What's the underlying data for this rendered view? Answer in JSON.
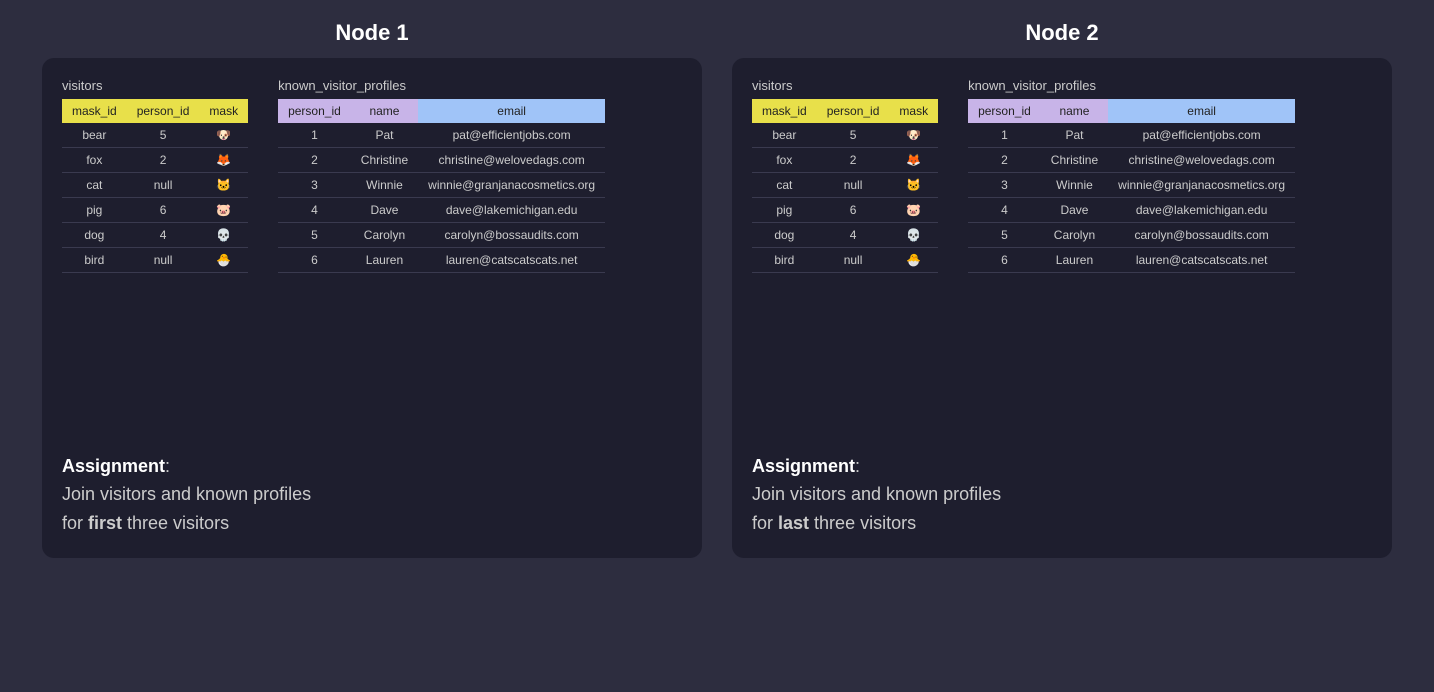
{
  "nodes": [
    {
      "title": "Node 1",
      "visitors_label": "visitors",
      "known_label": "known_visitor_profiles",
      "visitors_headers": [
        "mask_id",
        "person_id",
        "mask"
      ],
      "visitors_rows": [
        {
          "mask_id": "bear",
          "person_id": "5",
          "mask": "🐶"
        },
        {
          "mask_id": "fox",
          "person_id": "2",
          "mask": "🦊"
        },
        {
          "mask_id": "cat",
          "person_id": "null",
          "mask": "🐱"
        },
        {
          "mask_id": "pig",
          "person_id": "6",
          "mask": "🐷"
        },
        {
          "mask_id": "dog",
          "person_id": "4",
          "mask": "💀"
        },
        {
          "mask_id": "bird",
          "person_id": "null",
          "mask": "🐣"
        }
      ],
      "known_headers": [
        "person_id",
        "name",
        "email"
      ],
      "known_rows": [
        {
          "person_id": "1",
          "name": "Pat",
          "email": "pat@efficientjobs.com"
        },
        {
          "person_id": "2",
          "name": "Christine",
          "email": "christine@welovedags.com"
        },
        {
          "person_id": "3",
          "name": "Winnie",
          "email": "winnie@granjanacosmetics.org"
        },
        {
          "person_id": "4",
          "name": "Dave",
          "email": "dave@lakemichigan.edu"
        },
        {
          "person_id": "5",
          "name": "Carolyn",
          "email": "carolyn@bossaudits.com"
        },
        {
          "person_id": "6",
          "name": "Lauren",
          "email": "lauren@catscatscats.net"
        }
      ],
      "assignment_prefix": "Assignment",
      "assignment_line1": "Join visitors and known profiles",
      "assignment_highlight": "first",
      "assignment_suffix": "three visitors"
    },
    {
      "title": "Node 2",
      "visitors_label": "visitors",
      "known_label": "known_visitor_profiles",
      "visitors_headers": [
        "mask_id",
        "person_id",
        "mask"
      ],
      "visitors_rows": [
        {
          "mask_id": "bear",
          "person_id": "5",
          "mask": "🐶"
        },
        {
          "mask_id": "fox",
          "person_id": "2",
          "mask": "🦊"
        },
        {
          "mask_id": "cat",
          "person_id": "null",
          "mask": "🐱"
        },
        {
          "mask_id": "pig",
          "person_id": "6",
          "mask": "🐷"
        },
        {
          "mask_id": "dog",
          "person_id": "4",
          "mask": "💀"
        },
        {
          "mask_id": "bird",
          "person_id": "null",
          "mask": "🐣"
        }
      ],
      "known_headers": [
        "person_id",
        "name",
        "email"
      ],
      "known_rows": [
        {
          "person_id": "1",
          "name": "Pat",
          "email": "pat@efficientjobs.com"
        },
        {
          "person_id": "2",
          "name": "Christine",
          "email": "christine@welovedags.com"
        },
        {
          "person_id": "3",
          "name": "Winnie",
          "email": "winnie@granjanacosmetics.org"
        },
        {
          "person_id": "4",
          "name": "Dave",
          "email": "dave@lakemichigan.edu"
        },
        {
          "person_id": "5",
          "name": "Carolyn",
          "email": "carolyn@bossaudits.com"
        },
        {
          "person_id": "6",
          "name": "Lauren",
          "email": "lauren@catscatscats.net"
        }
      ],
      "assignment_prefix": "Assignment",
      "assignment_line1": "Join visitors and known profiles",
      "assignment_highlight": "last",
      "assignment_suffix": "three visitors"
    }
  ]
}
